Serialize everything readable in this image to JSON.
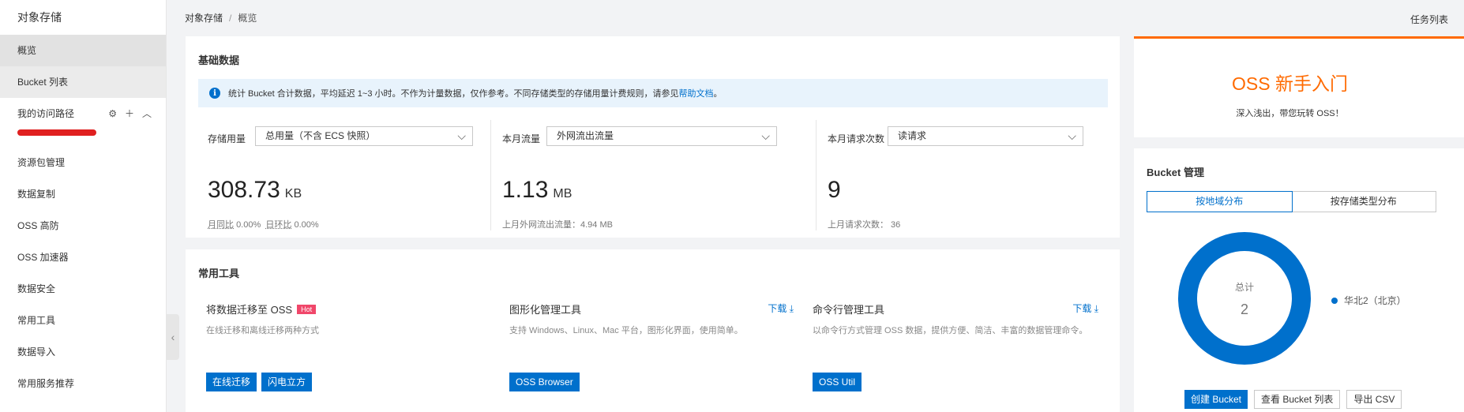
{
  "sidebar": {
    "title": "对象存储",
    "items": [
      {
        "label": "概览"
      },
      {
        "label": "Bucket 列表"
      }
    ],
    "path_label": "我的访问路径",
    "menu": [
      {
        "label": "资源包管理"
      },
      {
        "label": "数据复制"
      },
      {
        "label": "OSS 高防"
      },
      {
        "label": "OSS 加速器"
      },
      {
        "label": "数据安全"
      },
      {
        "label": "常用工具"
      },
      {
        "label": "数据导入"
      },
      {
        "label": "常用服务推荐"
      }
    ]
  },
  "topbar": {
    "breadcrumb": [
      "对象存储",
      "概览"
    ],
    "separator": "/",
    "task_list": "任务列表"
  },
  "basic": {
    "title": "基础数据",
    "notice_text": "统计 Bucket 合计数据，平均延迟 1~3 小时。不作为计量数据，仅作参考。不同存储类型的存储用量计费规则，请参见",
    "notice_link": "帮助文档",
    "notice_end": "。",
    "metrics": [
      {
        "label": "存储用量",
        "select": "总用量（不含 ECS 快照）",
        "value": "308.73",
        "unit": "KB",
        "sub_a": "月同比",
        "sub_a_val": "0.00%",
        "sub_b": "日环比",
        "sub_b_val": "0.00%"
      },
      {
        "label": "本月流量",
        "select": "外网流出流量",
        "value": "1.13",
        "unit": "MB",
        "sub": "上月外网流出流量：4.94 MB"
      },
      {
        "label": "本月请求次数",
        "select": "读请求",
        "value": "9",
        "unit": "",
        "sub": "上月请求次数：  36"
      }
    ]
  },
  "tools": {
    "title": "常用工具",
    "items": [
      {
        "name": "将数据迁移至 OSS",
        "badge": "Hot",
        "desc": "在线迁移和离线迁移两种方式",
        "buttons": [
          "在线迁移",
          "闪电立方"
        ]
      },
      {
        "name": "图形化管理工具",
        "download": "下载",
        "desc": "支持 Windows、Linux、Mac 平台，图形化界面，使用简单。",
        "buttons": [
          "OSS Browser"
        ]
      },
      {
        "name": "命令行管理工具",
        "download": "下载",
        "desc": "以命令行方式管理 OSS 数据，提供方便、简洁、丰富的数据管理命令。",
        "buttons": [
          "OSS Util"
        ]
      }
    ]
  },
  "newbie": {
    "title": "OSS 新手入门",
    "subtitle": "深入浅出，带您玩转 OSS！"
  },
  "bucket_mgmt": {
    "title": "Bucket 管理",
    "tabs": [
      "按地域分布",
      "按存储类型分布"
    ],
    "total_label": "总计",
    "total_value": "2",
    "legend": "华北2（北京）",
    "buttons": [
      "创建 Bucket",
      "查看 Bucket 列表",
      "导出 CSV"
    ]
  },
  "chart_data": {
    "type": "pie",
    "categories": [
      "华北2（北京）"
    ],
    "values": [
      2
    ]
  },
  "colors": {
    "accent": "#0070cc",
    "orange": "#ff6a00",
    "hot": "#f0476a"
  }
}
